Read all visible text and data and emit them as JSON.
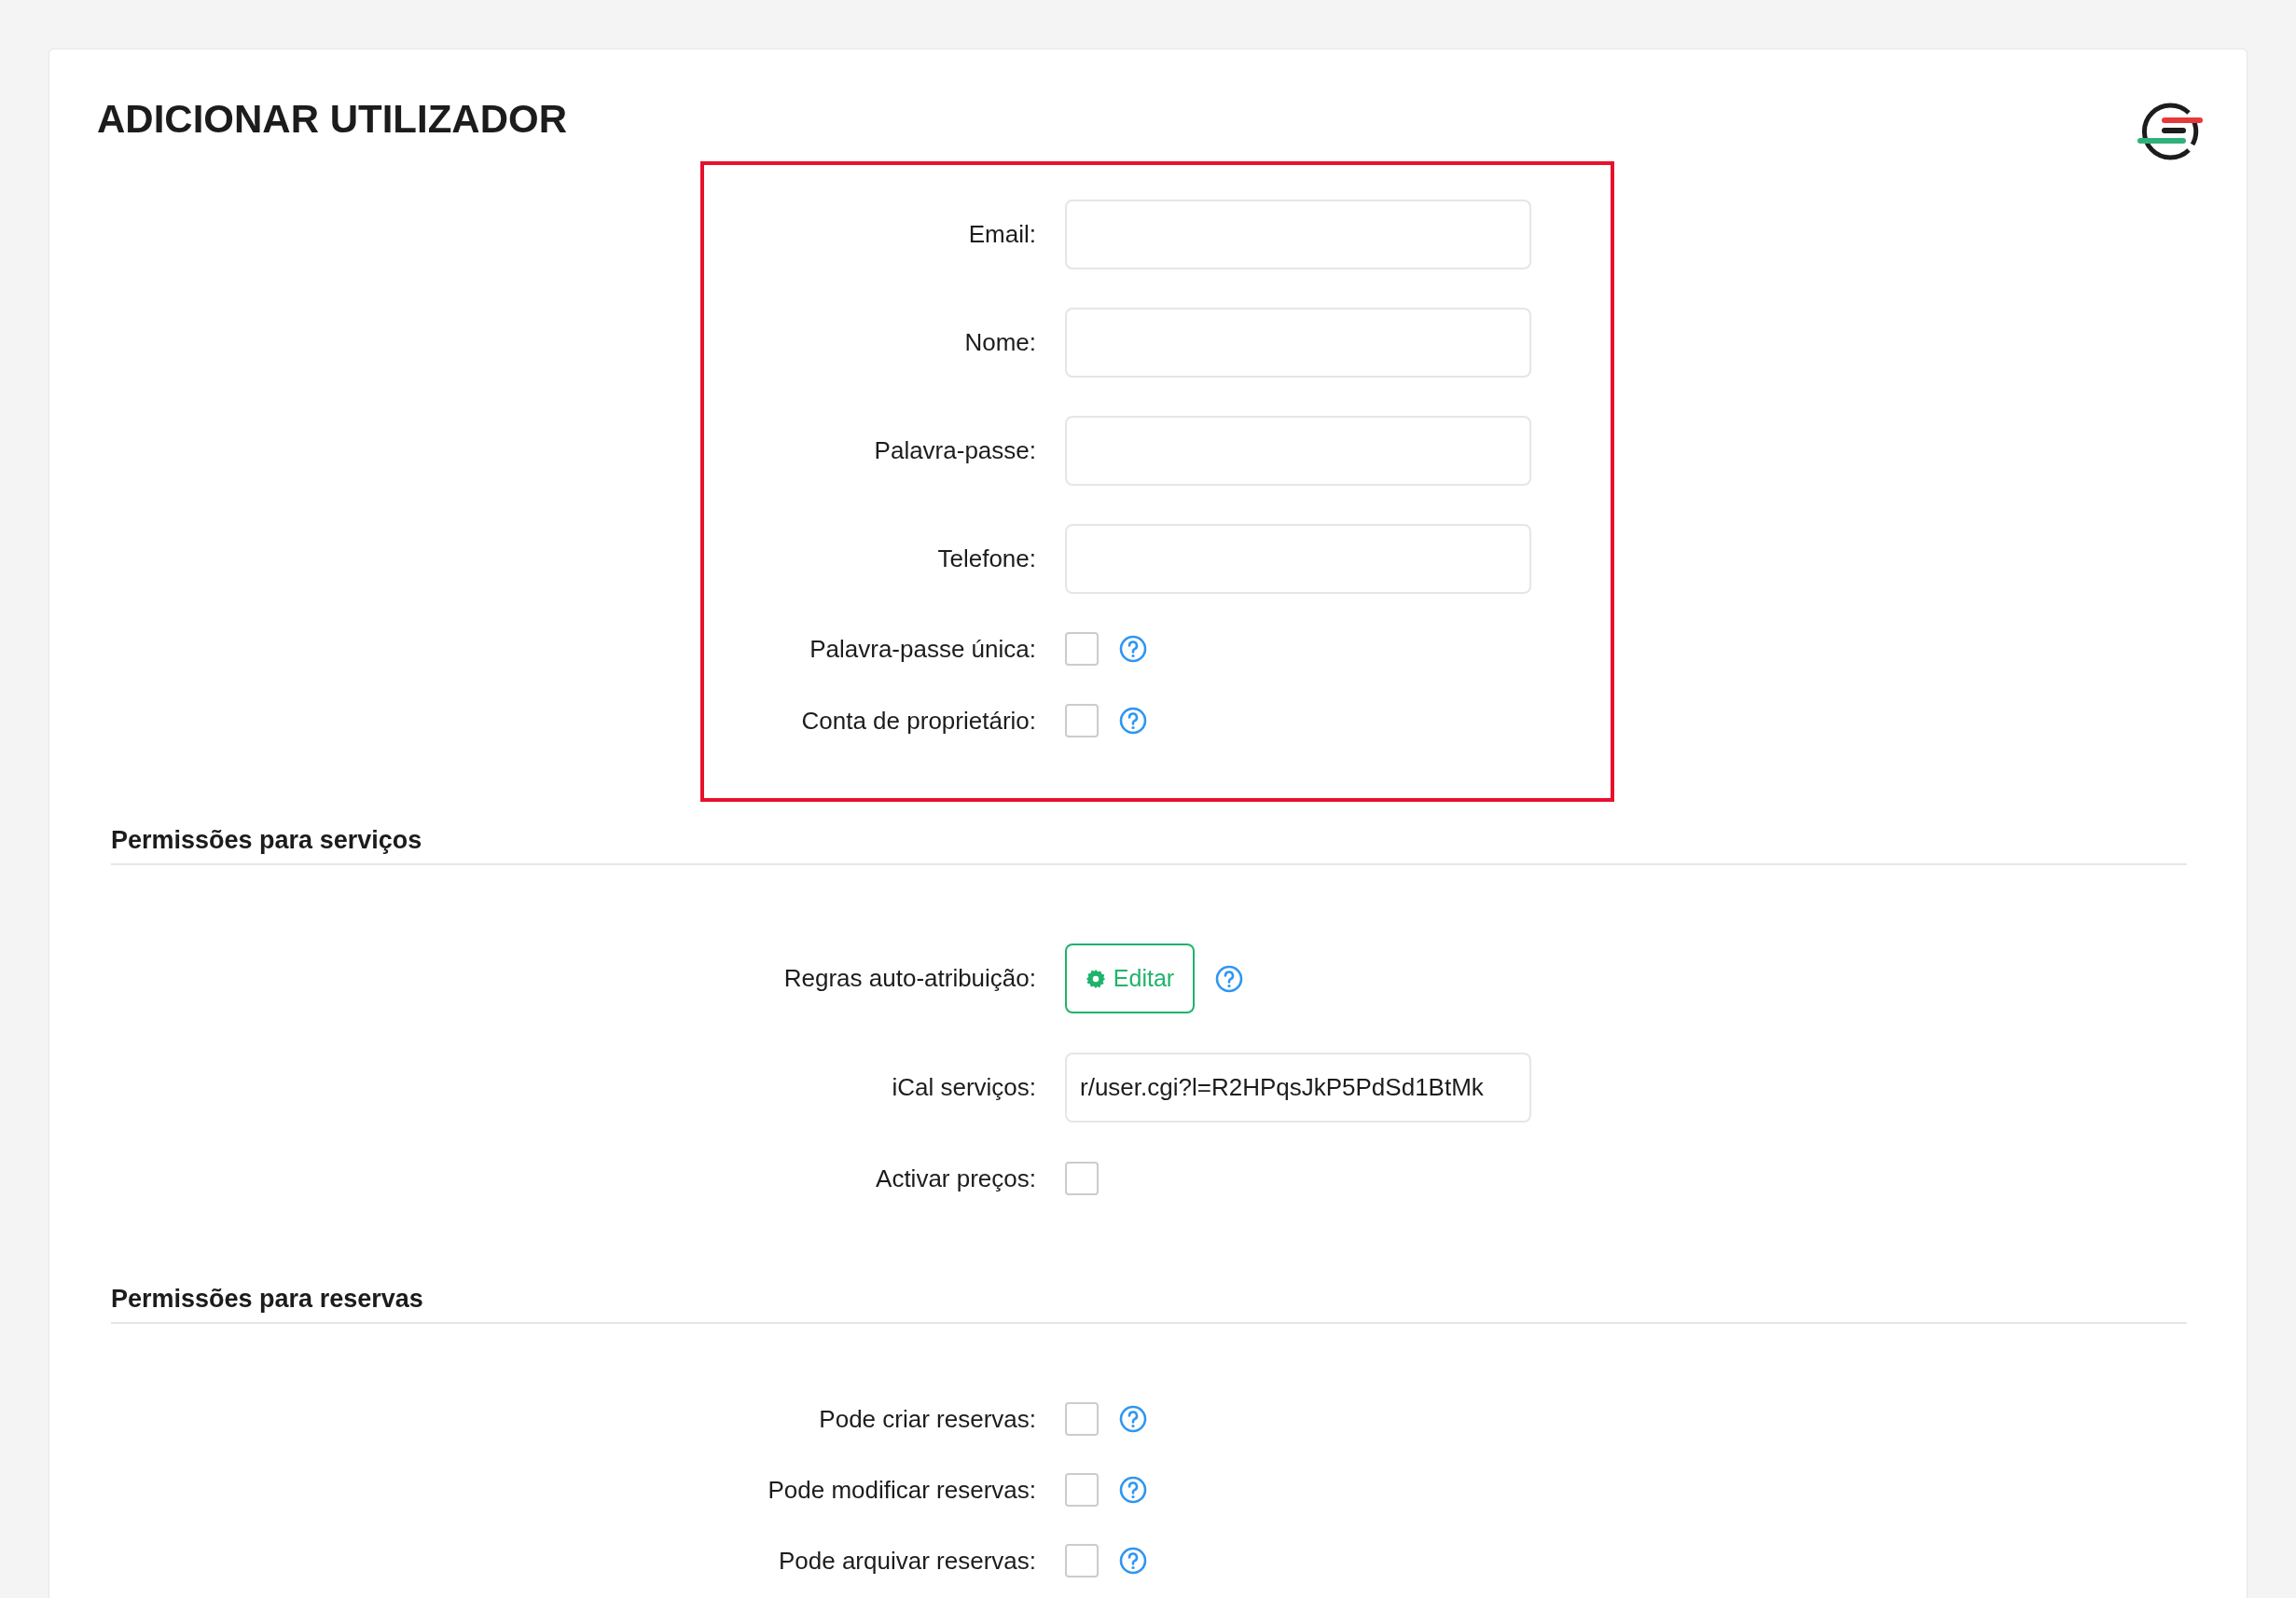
{
  "title": "ADICIONAR UTILIZADOR",
  "main_fields": [
    {
      "kind": "text",
      "label": "Email:"
    },
    {
      "kind": "text",
      "label": "Nome:"
    },
    {
      "kind": "text",
      "label": "Palavra-passe:"
    },
    {
      "kind": "text",
      "label": "Telefone:"
    },
    {
      "kind": "checkbox",
      "label": "Palavra-passe única:",
      "checked": false,
      "help": true
    },
    {
      "kind": "checkbox",
      "label": "Conta de proprietário:",
      "checked": false,
      "help": true
    }
  ],
  "sections": [
    {
      "heading": "Permissões para serviços",
      "fields": [
        {
          "kind": "button",
          "label": "Regras auto-atribuição:",
          "button": "Editar",
          "help": true
        },
        {
          "kind": "text",
          "label": "iCal serviços:",
          "value": "r/user.cgi?l=R2HPqsJkP5PdSd1BtMk"
        },
        {
          "kind": "checkbox",
          "label": "Activar preços:",
          "checked": false,
          "help": false
        }
      ]
    },
    {
      "heading": "Permissões para reservas",
      "fields": [
        {
          "kind": "checkbox",
          "label": "Pode criar reservas:",
          "checked": false,
          "help": true
        },
        {
          "kind": "checkbox",
          "label": "Pode modificar reservas:",
          "checked": false,
          "help": true
        },
        {
          "kind": "checkbox",
          "label": "Pode arquivar reservas:",
          "checked": false,
          "help": true
        }
      ]
    }
  ]
}
